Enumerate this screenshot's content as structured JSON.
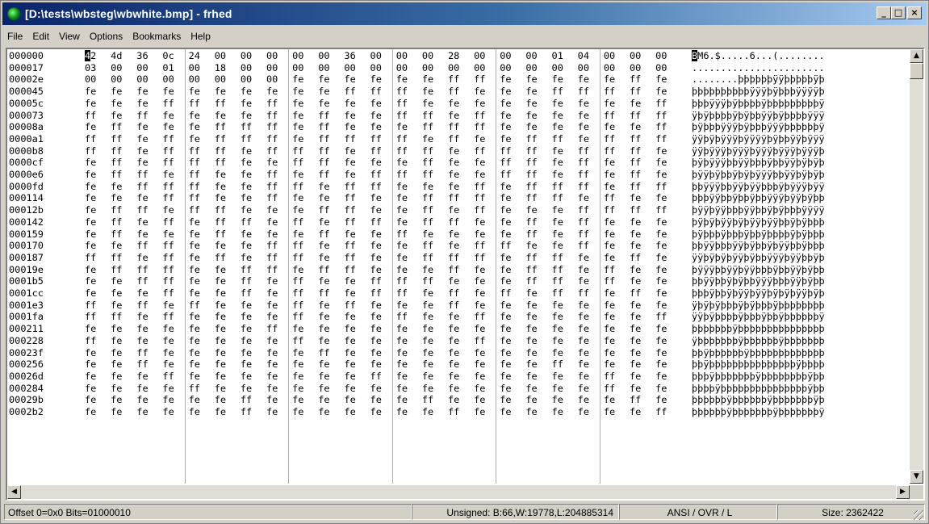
{
  "window": {
    "title": "[D:\\tests\\wbsteg\\wbwhite.bmp] - frhed",
    "min_label": "_",
    "max_label": "□",
    "close_label": "×"
  },
  "menu": [
    "File",
    "Edit",
    "View",
    "Options",
    "Bookmarks",
    "Help"
  ],
  "hex": {
    "cursor": {
      "row": 0,
      "col": 0
    },
    "rows": [
      {
        "offset": "000000",
        "bytes": "42 4d 36 0c 24 00 00 00 00 00 36 00 00 00 28 00 00 00 01 04 00 00 00",
        "ascii": "BM6.$.....6...(........"
      },
      {
        "offset": "000017",
        "bytes": "03 00 00 01 00 18 00 00 00 00 00 00 00 00 00 00 00 00 00 00 00 00 00",
        "ascii": "......................."
      },
      {
        "offset": "00002e",
        "bytes": "00 00 00 00 00 00 00 00 fe fe fe fe fe fe ff ff fe fe fe fe fe ff fe",
        "ascii": "........þþþþþþÿÿþþþþþÿþ"
      },
      {
        "offset": "000045",
        "bytes": "fe fe fe fe fe fe fe fe fe fe ff ff ff fe ff fe fe fe ff ff ff ff fe",
        "ascii": "þþþþþþþþþþÿÿÿþÿþþþÿÿÿÿþ"
      },
      {
        "offset": "00005c",
        "bytes": "fe fe fe ff ff ff fe ff fe fe fe fe ff fe fe fe fe fe fe fe fe fe ff",
        "ascii": "þþþÿÿÿþÿþþþþÿþþþþþþþþþÿ"
      },
      {
        "offset": "000073",
        "bytes": "ff fe ff fe fe fe fe ff fe ff fe fe ff ff fe ff fe fe fe fe ff ff ff",
        "ascii": "ÿþÿþþþþÿþÿþþÿÿþÿþþþþÿÿÿ"
      },
      {
        "offset": "00008a",
        "bytes": "fe ff fe fe fe ff ff ff fe ff fe fe fe ff ff ff fe fe fe fe fe fe ff",
        "ascii": "þÿþþþÿÿÿþÿþþþÿÿÿþþþþþþÿ"
      },
      {
        "offset": "0000a1",
        "bytes": "ff ff fe ff fe ff ff ff fe ff ff ff ff fe ff fe fe ff ff fe ff ff ff",
        "ascii": "ÿÿþÿþÿÿÿþÿÿÿÿþÿþþÿÿþÿÿÿ"
      },
      {
        "offset": "0000b8",
        "bytes": "ff ff fe ff ff ff fe ff ff ff fe ff ff ff fe ff ff ff fe ff ff ff fe",
        "ascii": "ÿÿþÿÿÿþÿÿÿþÿÿÿþÿÿÿþÿÿÿþ"
      },
      {
        "offset": "0000cf",
        "bytes": "fe ff fe ff ff ff fe fe ff ff fe fe fe ff fe fe ff ff fe ff fe ff fe",
        "ascii": "þÿþÿÿÿþþÿÿþþþÿþþÿÿþÿþÿþ"
      },
      {
        "offset": "0000e6",
        "bytes": "fe ff ff fe ff fe fe ff fe ff fe ff ff ff fe fe ff ff fe ff fe ff fe",
        "ascii": "þÿÿþÿþþÿþÿþÿÿÿþþÿÿþÿþÿþ"
      },
      {
        "offset": "0000fd",
        "bytes": "fe fe ff ff ff fe fe ff ff fe ff ff fe fe fe ff fe ff ff ff fe ff ff",
        "ascii": "þþÿÿÿþþÿÿþÿÿþþþÿþÿÿÿþÿÿ"
      },
      {
        "offset": "000114",
        "bytes": "fe fe fe ff ff fe fe ff fe fe ff fe fe ff ff ff fe ff ff fe ff fe fe",
        "ascii": "þþþÿÿþþÿþþÿþþÿÿÿþÿÿþÿþþ"
      },
      {
        "offset": "00012b",
        "bytes": "fe ff ff fe ff ff fe fe fe ff ff fe fe ff fe ff fe fe fe ff ff ff ff",
        "ascii": "þÿÿþÿÿþþþÿÿþþÿþÿþþþÿÿÿÿ"
      },
      {
        "offset": "000142",
        "bytes": "fe ff fe ff fe ff ff fe ff fe ff ff fe ff ff fe fe ff fe ff fe fe fe",
        "ascii": "þÿþÿþÿÿþÿþÿÿþÿÿþþÿþÿþþþ"
      },
      {
        "offset": "000159",
        "bytes": "fe ff fe fe fe ff fe fe fe ff fe fe ff fe fe fe fe ff fe ff fe fe fe",
        "ascii": "þÿþþþÿþþþÿþþÿþþþþÿþÿþþþ"
      },
      {
        "offset": "000170",
        "bytes": "fe fe ff ff fe fe fe ff ff fe ff fe fe ff fe ff ff fe fe ff fe fe fe",
        "ascii": "þþÿÿþþþÿÿþÿþþÿþÿÿþþÿþþþ"
      },
      {
        "offset": "000187",
        "bytes": "ff ff fe ff fe ff fe ff ff fe ff fe fe ff ff ff fe ff ff fe fe ff fe",
        "ascii": "ÿÿþÿþÿþÿÿþÿþþÿÿÿþÿÿþþÿþ"
      },
      {
        "offset": "00019e",
        "bytes": "fe ff ff ff fe fe ff ff fe ff ff fe fe fe ff fe fe ff ff fe ff fe fe",
        "ascii": "þÿÿÿþþÿÿþÿÿþþþÿþþÿÿþÿþþ"
      },
      {
        "offset": "0001b5",
        "bytes": "fe fe ff ff fe fe ff fe ff fe fe ff ff ff fe fe fe ff ff fe ff fe fe",
        "ascii": "þþÿÿþþÿþÿþþÿÿÿþþþÿÿþÿþþ"
      },
      {
        "offset": "0001cc",
        "bytes": "fe fe fe ff fe fe ff fe ff ff fe ff ff fe ff fe ff fe ff ff fe ff fe",
        "ascii": "þþþÿþþÿþÿÿþÿÿþÿþÿþÿÿþÿþ"
      },
      {
        "offset": "0001e3",
        "bytes": "ff fe ff fe ff fe fe fe ff fe ff fe fe fe ff fe fe fe fe fe fe fe fe",
        "ascii": "ÿþÿþÿþþþÿþÿþþþÿþþþþþþþþ"
      },
      {
        "offset": "0001fa",
        "bytes": "ff ff fe ff fe fe fe fe ff fe fe fe ff fe fe ff fe fe fe fe fe fe ff",
        "ascii": "ÿÿþÿþþþþÿþþþÿþþÿþþþþþþÿ"
      },
      {
        "offset": "000211",
        "bytes": "fe fe fe fe fe fe fe ff fe fe fe fe fe fe fe fe fe fe fe fe fe fe fe",
        "ascii": "þþþþþþþÿþþþþþþþþþþþþþþþ"
      },
      {
        "offset": "000228",
        "bytes": "ff fe fe fe fe fe fe fe ff fe fe fe fe fe fe ff fe fe fe fe fe fe fe",
        "ascii": "ÿþþþþþþþÿþþþþþþÿþþþþþþþ"
      },
      {
        "offset": "00023f",
        "bytes": "fe fe ff fe fe fe fe fe fe ff fe fe fe fe fe fe fe fe fe fe fe fe fe",
        "ascii": "þþÿþþþþþþÿþþþþþþþþþþþþþ"
      },
      {
        "offset": "000256",
        "bytes": "fe fe ff fe fe fe fe fe fe fe fe fe fe fe fe fe fe fe ff fe fe fe fe",
        "ascii": "þþÿþþþþþþþþþþþþþþþÿþþþþ"
      },
      {
        "offset": "00026d",
        "bytes": "fe fe fe ff fe fe fe fe fe fe fe ff fe fe fe fe fe fe fe fe ff fe fe",
        "ascii": "þþþÿþþþþþþþÿþþþþþþþþÿþþ"
      },
      {
        "offset": "000284",
        "bytes": "fe fe fe fe ff fe fe fe fe fe fe fe fe fe fe fe fe fe fe fe ff fe fe",
        "ascii": "þþþþÿþþþþþþþþþþþþþþþÿþþ"
      },
      {
        "offset": "00029b",
        "bytes": "fe fe fe fe fe fe ff fe fe fe fe fe fe ff fe fe fe fe fe fe fe ff fe",
        "ascii": "þþþþþþÿþþþþþþÿþþþþþþþÿþ"
      },
      {
        "offset": "0002b2",
        "bytes": "fe fe fe fe fe fe ff fe fe fe fe fe fe fe ff fe fe fe fe fe fe fe ff",
        "ascii": "þþþþþþÿþþþþþþþÿþþþþþþþÿ"
      }
    ]
  },
  "status": {
    "offset": "Offset 0=0x0   Bits=01000010",
    "unsigned": "Unsigned: B:66,W:19778,L:204885314",
    "mode": "ANSI / OVR / L",
    "size": "Size: 2362422"
  },
  "scroll": {
    "up": "▲",
    "down": "▼",
    "left": "◀",
    "right": "▶"
  },
  "colors": {
    "title_start": "#0a246a",
    "title_end": "#a6caf0",
    "chrome": "#d4d0c8",
    "cursor_bg": "#000000"
  }
}
